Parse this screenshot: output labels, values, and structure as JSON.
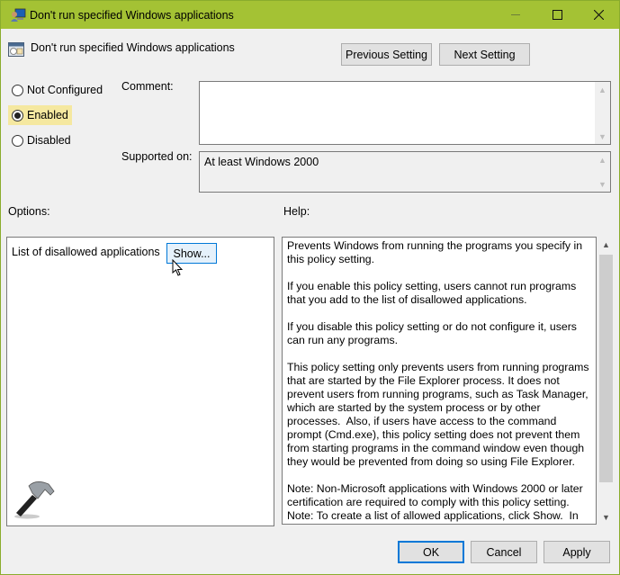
{
  "window": {
    "title": "Don't run specified Windows applications",
    "controls": {
      "minimize": "minimize-icon",
      "maximize": "maximize-icon",
      "close": "close-icon"
    },
    "accent_color": "#a4c234"
  },
  "header": {
    "setting_name": "Don't run specified Windows applications",
    "previous_label": "Previous Setting",
    "next_label": "Next Setting"
  },
  "state": {
    "options": [
      {
        "label": "Not Configured",
        "selected": false
      },
      {
        "label": "Enabled",
        "selected": true
      },
      {
        "label": "Disabled",
        "selected": false
      }
    ]
  },
  "comment": {
    "label": "Comment:",
    "value": ""
  },
  "supported": {
    "label": "Supported on:",
    "value": "At least Windows 2000"
  },
  "options": {
    "label": "Options:",
    "list_label": "List of disallowed applications",
    "show_button": "Show..."
  },
  "help": {
    "label": "Help:",
    "text": "Prevents Windows from running the programs you specify in this policy setting.\n\nIf you enable this policy setting, users cannot run programs that you add to the list of disallowed applications.\n\nIf you disable this policy setting or do not configure it, users can run any programs.\n\nThis policy setting only prevents users from running programs that are started by the File Explorer process. It does not prevent users from running programs, such as Task Manager, which are started by the system process or by other processes.  Also, if users have access to the command prompt (Cmd.exe), this policy setting does not prevent them from starting programs in the command window even though they would be prevented from doing so using File Explorer.\n\nNote: Non-Microsoft applications with Windows 2000 or later certification are required to comply with this policy setting.\nNote: To create a list of allowed applications, click Show.  In the"
  },
  "footer": {
    "ok": "OK",
    "cancel": "Cancel",
    "apply": "Apply"
  }
}
